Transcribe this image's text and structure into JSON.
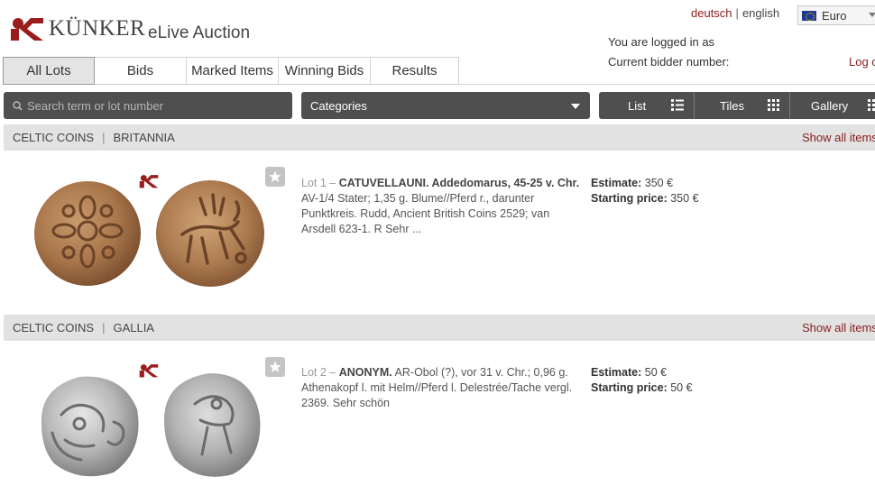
{
  "header": {
    "brand": "KÜNKER",
    "product": "eLive Auction",
    "languages": [
      "deutsch",
      "english"
    ],
    "language_separator": "|",
    "currency": "Euro",
    "logged_in_text": "You are logged in as",
    "bidder_number_text": "Current bidder number:",
    "logout_text": "Log o"
  },
  "tabs": [
    {
      "label": "All Lots",
      "active": true
    },
    {
      "label": "Bids"
    },
    {
      "label": "Marked Items"
    },
    {
      "label": "Winning Bids"
    },
    {
      "label": "Results"
    }
  ],
  "toolbar": {
    "search_placeholder": "Search term or lot number",
    "categories_label": "Categories",
    "views": [
      "List",
      "Tiles",
      "Gallery"
    ]
  },
  "sections": [
    {
      "category": "CELTIC COINS",
      "subcategory": "BRITANNIA",
      "show_all": "Show all items",
      "lot": {
        "number": "Lot 1 –",
        "title": "CATUVELLAUNI. Addedomarus, 45-25 v. Chr.",
        "description": "AV-1/4 Stater; 1,35 g. Blume//Pferd r., darunter Punktkreis. Rudd, Ancient British Coins 2529; van Arsdell 623-1. R Sehr ...",
        "estimate_label": "Estimate:",
        "estimate_value": "350 €",
        "start_label": "Starting price:",
        "start_value": "350 €"
      }
    },
    {
      "category": "CELTIC COINS",
      "subcategory": "GALLIA",
      "show_all": "Show all items",
      "lot": {
        "number": "Lot 2 –",
        "title": "ANONYM.",
        "description": "AR-Obol (?), vor 31 v. Chr.; 0,96 g. Athenakopf l. mit Helm//Pferd l. Delestrée/Tache vergl. 2369. Sehr schön",
        "estimate_label": "Estimate:",
        "estimate_value": "50 €",
        "start_label": "Starting price:",
        "start_value": "50 €"
      }
    }
  ],
  "colors": {
    "brand_red": "#8a1c1c",
    "toolbar_dark": "#4f4f4f",
    "category_bar": "#e2e2e2"
  }
}
